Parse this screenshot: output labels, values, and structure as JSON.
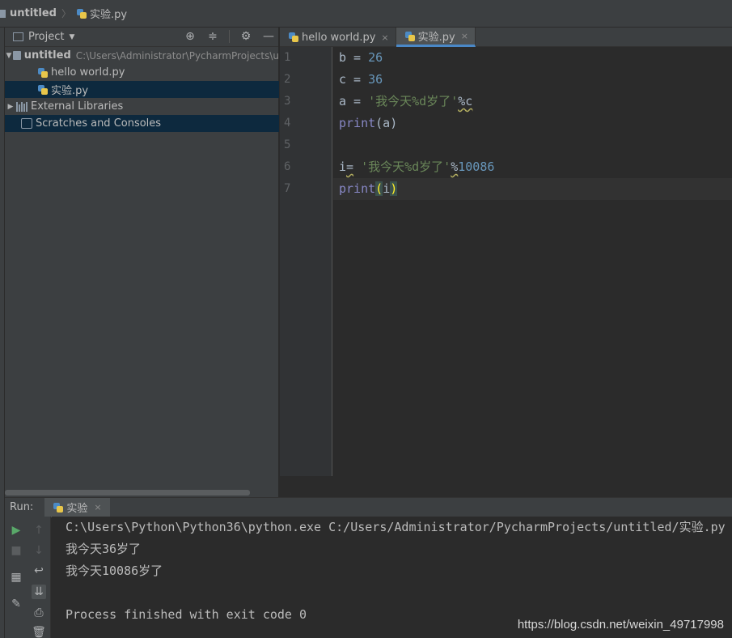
{
  "breadcrumb": {
    "project": "untitled",
    "file": "实验.py"
  },
  "project_panel": {
    "title": "Project",
    "tree": [
      {
        "label": "untitled",
        "path": "C:\\Users\\Administrator\\PycharmProjects\\u"
      },
      {
        "label": "hello world.py"
      },
      {
        "label": "实验.py"
      },
      {
        "label": "External Libraries"
      },
      {
        "label": "Scratches and Consoles"
      }
    ]
  },
  "editor": {
    "tabs": [
      {
        "label": "hello world.py",
        "close": "×"
      },
      {
        "label": "实验.py",
        "close": "×"
      }
    ],
    "line_numbers": [
      "1",
      "2",
      "3",
      "4",
      "5",
      "6",
      "7"
    ],
    "code": {
      "l1": {
        "name": "b",
        "op": " = ",
        "num": "26"
      },
      "l2": {
        "name": "c",
        "op": " = ",
        "num": "36"
      },
      "l3": {
        "name": "a",
        "op": " = ",
        "str": "'我今天%d岁了'",
        "tail": "%c"
      },
      "l4": {
        "fn": "print",
        "args": "(a)"
      },
      "l6": {
        "name": "i",
        "eq": "=",
        "str": "'我今天%d岁了'",
        "pct": "%",
        "num": "10086"
      },
      "l7": {
        "fn": "print",
        "open": "(",
        "arg": "i",
        "close": ")"
      }
    }
  },
  "run": {
    "label": "Run:",
    "tab": "实验",
    "tab_close": "×",
    "console": [
      "C:\\Users\\Python\\Python36\\python.exe C:/Users/Administrator/PycharmProjects/untitled/实验.py",
      "我今天36岁了",
      "我今天10086岁了",
      "",
      "Process finished with exit code 0"
    ]
  },
  "watermark": "https://blog.csdn.net/weixin_49717998",
  "colors": {
    "accent": "#4a88c7",
    "selection": "#0d293e",
    "string": "#6a8759",
    "number": "#6897bb"
  }
}
